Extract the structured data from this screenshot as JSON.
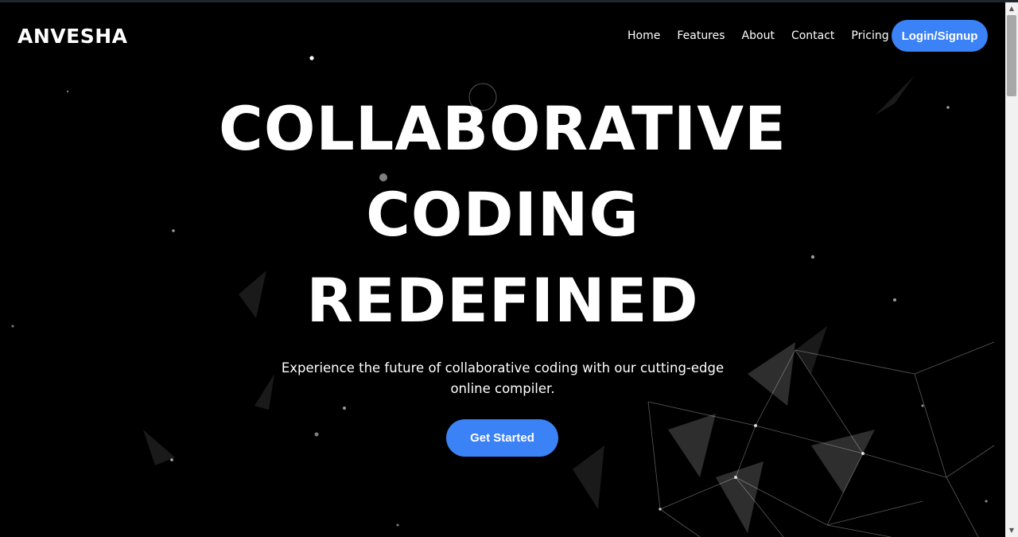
{
  "navbar": {
    "brand": "ANVESHA",
    "links": [
      "Home",
      "Features",
      "About",
      "Contact",
      "Pricing"
    ],
    "login_label": "Login/Signup"
  },
  "hero": {
    "title_lines": [
      "COLLABORATIVE",
      "CODING",
      "REDEFINED"
    ],
    "subtitle": "Experience the future of collaborative coding with our cutting-edge online compiler.",
    "cta_label": "Get Started"
  },
  "scrollbar": {
    "up_icon": "▲",
    "down_icon": "▼"
  },
  "colors": {
    "background": "#000000",
    "accent": "#3b82f6",
    "text": "#ffffff"
  }
}
